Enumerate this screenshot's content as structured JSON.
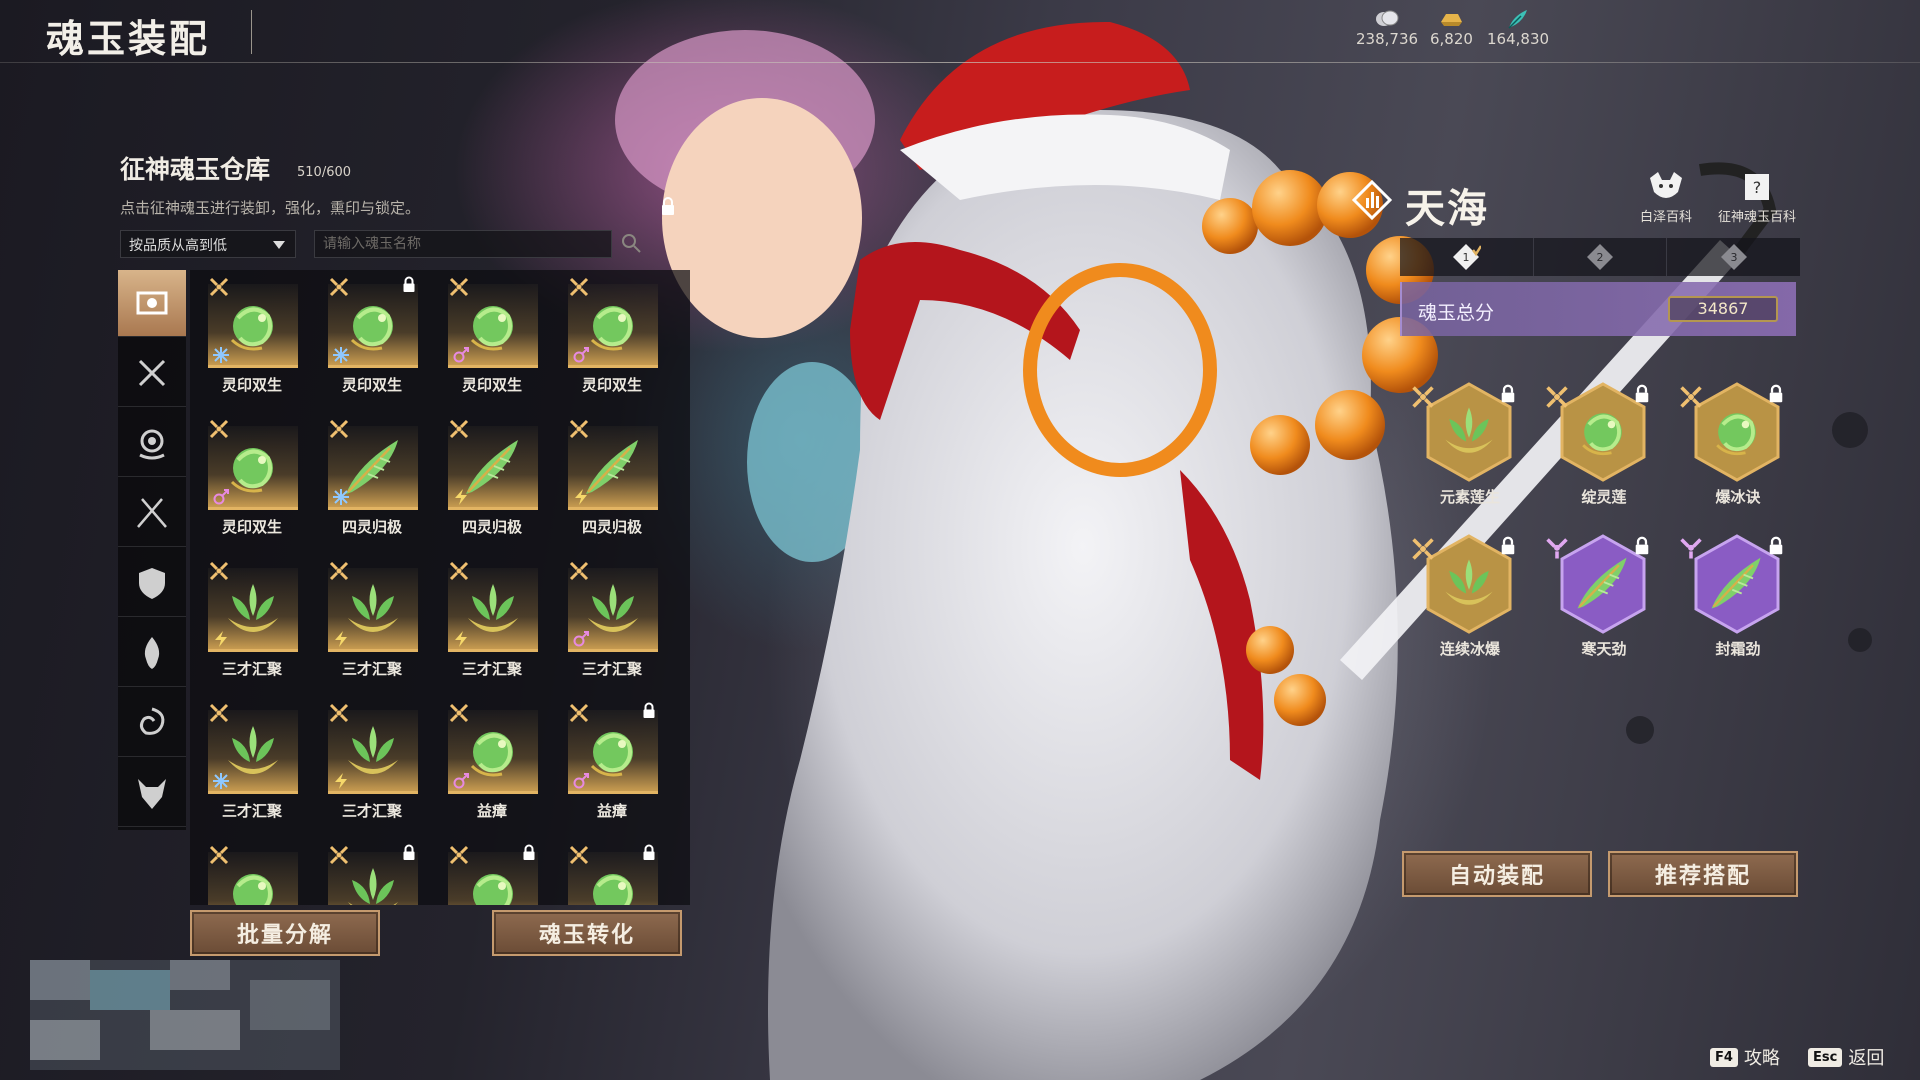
{
  "header": {
    "title": "魂玉装配",
    "currencies": [
      {
        "icon": "coin-stack-icon",
        "value": "238,736"
      },
      {
        "icon": "gold-ingot-icon",
        "value": "6,820"
      },
      {
        "icon": "feather-icon",
        "value": "164,830"
      }
    ]
  },
  "warehouse": {
    "title": "征神魂玉仓库",
    "count": "510/600",
    "hint": "点击征神魂玉进行装卸，强化，熏印与锁定。",
    "sort": {
      "selected": "按品质从高到低"
    },
    "search": {
      "placeholder": "请输入魂玉名称"
    },
    "tabs": [
      {
        "icon": "all-items-icon",
        "active": true
      },
      {
        "icon": "crossed-swords-icon"
      },
      {
        "icon": "spiral-icon"
      },
      {
        "icon": "crossed-blades-icon"
      },
      {
        "icon": "shield-icon"
      },
      {
        "icon": "flame-icon"
      },
      {
        "icon": "swirl-icon"
      },
      {
        "icon": "demon-mask-icon"
      }
    ],
    "items": [
      {
        "name": "灵印双生",
        "type": "dragon",
        "elem": "ice",
        "locked": false
      },
      {
        "name": "灵印双生",
        "type": "dragon",
        "elem": "ice",
        "locked": true
      },
      {
        "name": "灵印双生",
        "type": "dragon",
        "elem": "gender",
        "locked": false
      },
      {
        "name": "灵印双生",
        "type": "dragon",
        "elem": "gender",
        "locked": false
      },
      {
        "name": "灵印双生",
        "type": "dragon",
        "elem": "gender",
        "locked": false
      },
      {
        "name": "四灵归极",
        "type": "feather",
        "elem": "ice",
        "locked": false
      },
      {
        "name": "四灵归极",
        "type": "feather",
        "elem": "bolt",
        "locked": false
      },
      {
        "name": "四灵归极",
        "type": "feather",
        "elem": "bolt",
        "locked": false
      },
      {
        "name": "三才汇聚",
        "type": "lotus",
        "elem": "bolt",
        "locked": false
      },
      {
        "name": "三才汇聚",
        "type": "lotus",
        "elem": "bolt",
        "locked": false
      },
      {
        "name": "三才汇聚",
        "type": "lotus",
        "elem": "bolt",
        "locked": false
      },
      {
        "name": "三才汇聚",
        "type": "lotus",
        "elem": "gender",
        "locked": false
      },
      {
        "name": "三才汇聚",
        "type": "lotus",
        "elem": "ice",
        "locked": false
      },
      {
        "name": "三才汇聚",
        "type": "lotus",
        "elem": "bolt",
        "locked": false
      },
      {
        "name": "益瘴",
        "type": "dragon",
        "elem": "gender",
        "locked": false
      },
      {
        "name": "益瘴",
        "type": "dragon",
        "elem": "gender",
        "locked": true
      },
      {
        "name": "",
        "type": "dragon",
        "elem": "",
        "locked": false
      },
      {
        "name": "",
        "type": "lotus",
        "elem": "",
        "locked": true
      },
      {
        "name": "",
        "type": "dragon",
        "elem": "",
        "locked": true
      },
      {
        "name": "",
        "type": "dragon",
        "elem": "",
        "locked": true
      }
    ],
    "buttons": {
      "decompose": "批量分解",
      "convert": "魂玉转化"
    }
  },
  "character": {
    "name": "天海",
    "encyclopedias": [
      {
        "icon": "baize-icon",
        "label": "白泽百科"
      },
      {
        "icon": "book-icon",
        "label": "征神魂玉百科"
      }
    ],
    "sets": [
      {
        "icon": "set-1-icon",
        "label": "1",
        "checked": true
      },
      {
        "icon": "set-2-icon",
        "label": "2",
        "checked": false
      },
      {
        "icon": "set-3-icon",
        "label": "3",
        "checked": false
      }
    ],
    "score_label": "魂玉总分",
    "score": "34867",
    "slots": [
      {
        "name": "元素莲生",
        "rarity": "gold",
        "locked": true
      },
      {
        "name": "绽灵莲",
        "rarity": "gold",
        "locked": true
      },
      {
        "name": "爆冰诀",
        "rarity": "gold",
        "locked": true
      },
      {
        "name": "连续冰爆",
        "rarity": "gold",
        "locked": true
      },
      {
        "name": "寒天劲",
        "rarity": "purple",
        "locked": true
      },
      {
        "name": "封霜劲",
        "rarity": "purple",
        "locked": true
      }
    ],
    "buttons": {
      "auto": "自动装配",
      "recommend": "推荐搭配"
    }
  },
  "hotkeys": [
    {
      "key": "F4",
      "label": "攻略"
    },
    {
      "key": "Esc",
      "label": "返回"
    }
  ],
  "colors": {
    "gold": "#e2b463",
    "purple": "#8a5cc4",
    "score_bg": "#8c6eb4"
  }
}
